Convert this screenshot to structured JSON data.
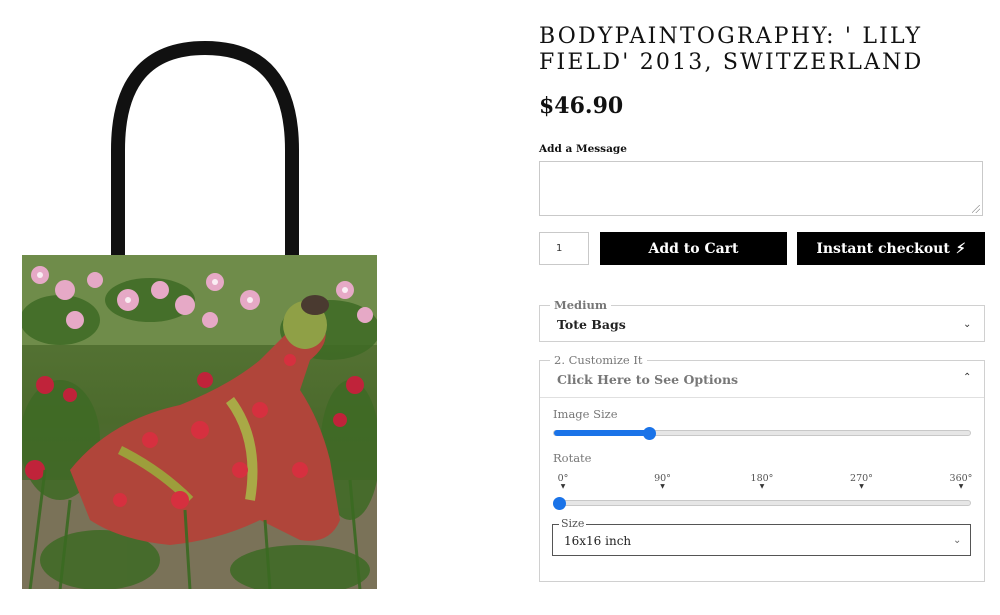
{
  "product": {
    "title": "BODYPAINTOGRAPHY: ' LILY FIELD' 2013, SWITZERLAND",
    "price": "$46.90",
    "image_icon": "tote-bag-photo"
  },
  "message": {
    "label": "Add a Message",
    "value": ""
  },
  "quantity": {
    "value": "1"
  },
  "buttons": {
    "add_to_cart": "Add to Cart",
    "instant_checkout": "Instant checkout",
    "instant_icon": "lightning-bolt-icon"
  },
  "medium": {
    "legend": "Medium",
    "value": "Tote Bags"
  },
  "customize": {
    "legend": "2. Customize It",
    "header": "Click Here to See Options",
    "image_size": {
      "label": "Image Size",
      "level": 0.23
    },
    "rotate": {
      "label": "Rotate",
      "ticks": [
        "0°",
        "90°",
        "180°",
        "270°",
        "360°"
      ],
      "value_deg": 0
    },
    "size": {
      "legend": "Size",
      "value": "16x16 inch"
    }
  },
  "colors": {
    "accent": "#1a73e8",
    "button_bg": "#000000",
    "button_text": "#ffffff"
  }
}
